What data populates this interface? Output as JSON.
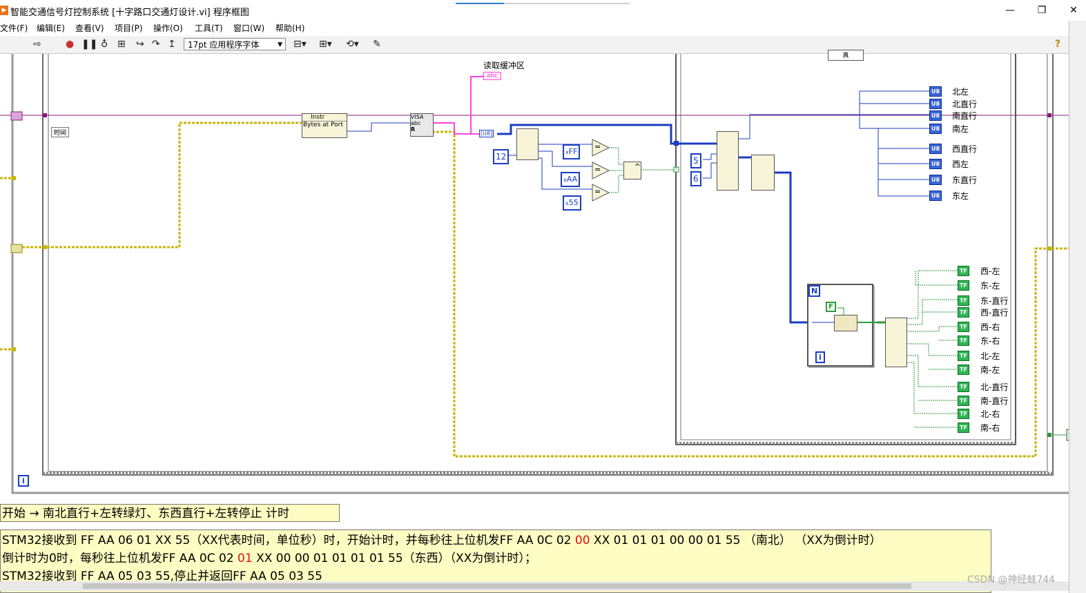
{
  "window": {
    "app_icon": "labview-icon",
    "title": "智能交通信号灯控制系统 [十字路口交通灯设计.vi] 程序框图",
    "buttons": {
      "minimize": "—",
      "restore": "❐",
      "close": "✕"
    }
  },
  "menu": {
    "items": [
      "文件(F)",
      "编辑(E)",
      "查看(V)",
      "项目(P)",
      "操作(O)",
      "工具(T)",
      "窗口(W)",
      "帮助(H)"
    ]
  },
  "toolbar": {
    "font_select": "17pt 应用程序字体",
    "help_icon": "?"
  },
  "diagram": {
    "time_label": "时间",
    "read_buffer_label": "读取缓冲区",
    "read_buffer_tag": "abc",
    "visa_instr": "Instr",
    "bytes_at_port": "Bytes at Port",
    "visa_read": "VISA",
    "visa_read_sub": "abc",
    "visa_read_r": "R",
    "u8_conv": "[U8]",
    "const_12": "12",
    "const_ff": "FF",
    "const_aa": "AA",
    "const_55": "55",
    "hex_prefix": "x",
    "eq_label": "=",
    "and_label": "^",
    "case_selector": "真",
    "const_5": "5",
    "const_6": "6",
    "true_tag": "T",
    "loop_n": "N",
    "loop_i": "i",
    "false_const": "F",
    "outer_loop_i": "i",
    "u8_tag": "U8",
    "tf_tag": "TF",
    "u8_indicators": [
      "北左",
      "北直行",
      "南直行",
      "南左",
      "西直行",
      "西左",
      "东直行",
      "东左"
    ],
    "tf_indicators": [
      "西-左",
      "东-左",
      "东-直行",
      "西-直行",
      "西-右",
      "东-右",
      "北-左",
      "南-左",
      "北-直行",
      "南-直行",
      "北-右",
      "南-右"
    ]
  },
  "annotation1": "开始 → 南北直行+左转绿灯、东西直行+左转停止 计时",
  "annotation2": {
    "line1_a": "STM32接收到 FF AA 06 01 XX 55（XX代表时间，单位秒）时，开始计时，并每秒往上位机发FF AA 0C 02 ",
    "line1_red": "00",
    "line1_b": " XX 01 01 01 00 00 01 55 （南北） （XX为倒计时）",
    "line2_a": "倒计时为0时，每秒往上位机发FF AA 0C 02 ",
    "line2_red": "01",
    "line2_b": " XX 00 00 01 01 01 01 55（东西）（XX为倒计时）；",
    "line3": "STM32接收到 FF AA 05 03 55,停止并返回FF AA 05 03 55"
  },
  "watermark": "CSDN @神经蛙744",
  "colors": {
    "u8_wire": "#1a3cc2",
    "bool_wire": "#2a9a3a",
    "string_wire": "#ff44dd",
    "error_wire": "#c8b400",
    "refnum_wire": "#8a1a7a",
    "annotation_bg": "#fdfcc2",
    "red_text": "#e01010"
  }
}
